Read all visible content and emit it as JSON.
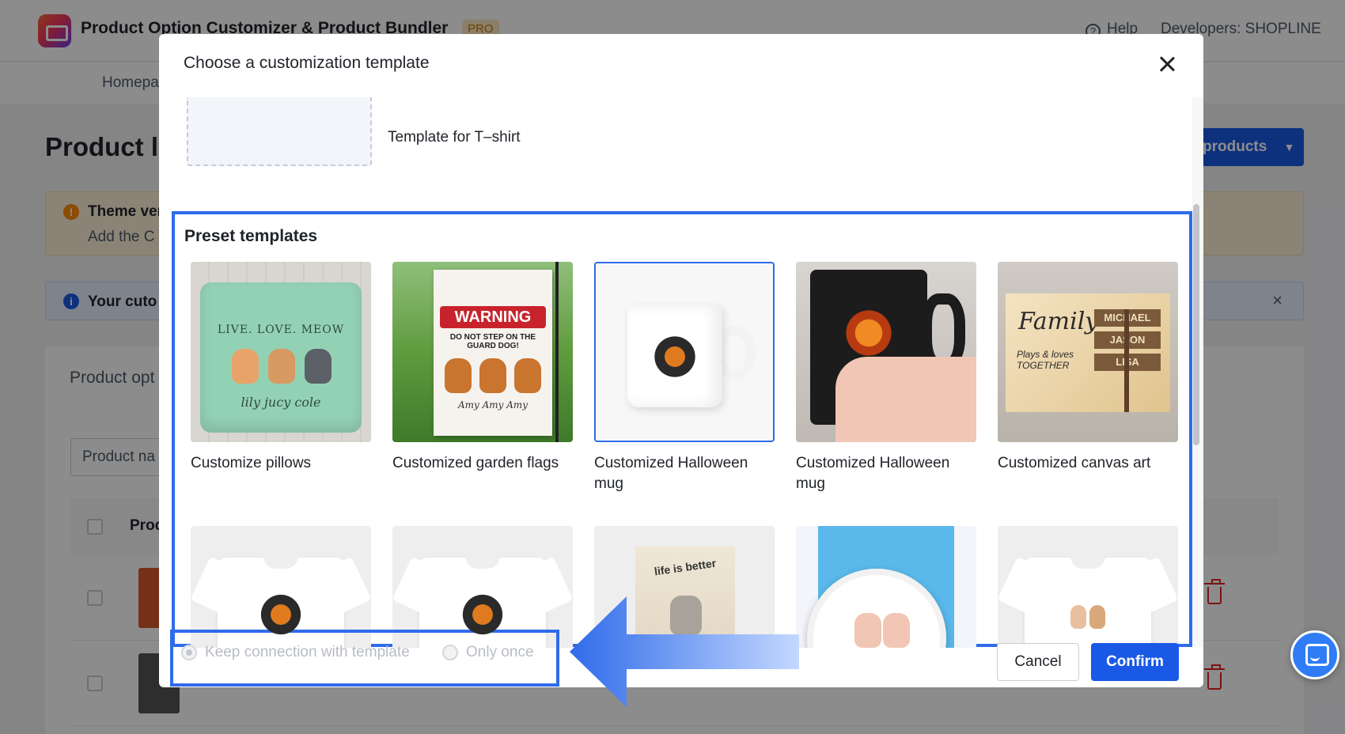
{
  "app": {
    "title": "Product Option Customizer & Product Bundler",
    "badge": "PRO",
    "help": "Help",
    "developer": "Developers: SHOPLINE",
    "breadcrumb": "Homepa",
    "page_title": "Product li",
    "primary_action": "products",
    "notice_warning_title": "Theme ver",
    "notice_warning_body": "Add the C",
    "notice_info": "Your cuto",
    "card_title": "Product opt",
    "search_placeholder": "Product na",
    "table_header": "Proc"
  },
  "modal": {
    "title": "Choose a customization template",
    "custom_template_label": "Template for T–shirt",
    "preset_title": "Preset templates",
    "templates": [
      {
        "name": "Customize pillows"
      },
      {
        "name": "Customized garden flags"
      },
      {
        "name": "Customized Halloween mug",
        "selected": true
      },
      {
        "name": "Customized Halloween mug"
      },
      {
        "name": "Customized canvas art"
      }
    ],
    "pillow_text": "LIVE. LOVE. MEOW",
    "pillow_names": "lily   jucy   cole",
    "flag_text": "WARNING",
    "flag_subtext": "DO NOT STEP ON THE GUARD DOG!",
    "flag_names": "Amy  Amy  Amy",
    "canvas_text": "Family",
    "canvas_subtext": "Plays & loves TOGETHER",
    "canvas_signs": [
      "MICHAEL",
      "JASON",
      "LISA"
    ],
    "card_text": "life is better",
    "options": {
      "keep_connection": "Keep connection with template",
      "only_once": "Only once",
      "selected": "keep_connection"
    },
    "cancel": "Cancel",
    "confirm": "Confirm"
  },
  "colors": {
    "primary": "#1a59e6",
    "highlight": "#2f6bea",
    "danger": "#e02424"
  }
}
